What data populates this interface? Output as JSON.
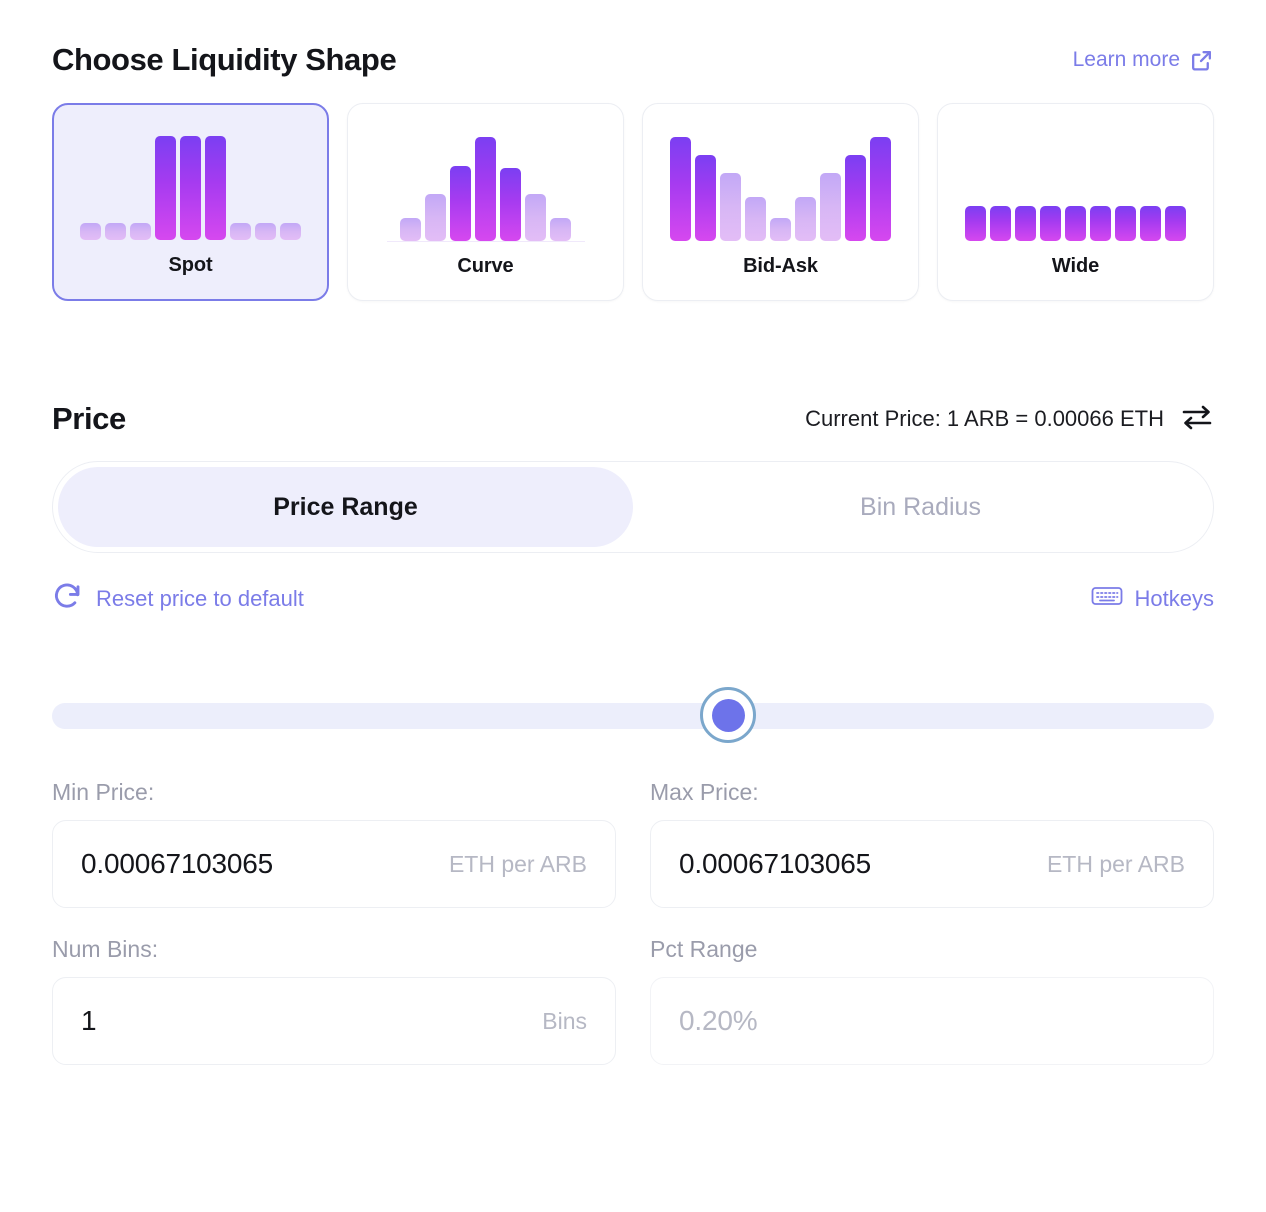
{
  "shape_section": {
    "title": "Choose Liquidity Shape",
    "learn_more": {
      "label": "Learn more",
      "icon": "external-link-icon"
    },
    "selected": "Spot",
    "cards": [
      {
        "label": "Spot",
        "bars": [
          16,
          16,
          16,
          100,
          100,
          100,
          16,
          16,
          16
        ],
        "faded": [
          true,
          true,
          true,
          false,
          false,
          false,
          true,
          true,
          true
        ],
        "baseline": false
      },
      {
        "label": "Curve",
        "bars": [
          0,
          22,
          45,
          72,
          100,
          70,
          45,
          22,
          0
        ],
        "faded": [
          true,
          true,
          false,
          false,
          false,
          false,
          true,
          true,
          true
        ],
        "baseline": true
      },
      {
        "label": "Bid-Ask",
        "bars": [
          100,
          83,
          65,
          42,
          22,
          42,
          65,
          83,
          100
        ],
        "faded": [
          false,
          false,
          true,
          true,
          true,
          true,
          true,
          false,
          false
        ],
        "baseline": false
      },
      {
        "label": "Wide",
        "bars": [
          34,
          34,
          34,
          34,
          34,
          34,
          34,
          34,
          34
        ],
        "faded": [
          false,
          false,
          false,
          false,
          false,
          false,
          false,
          false,
          false
        ],
        "baseline": false
      }
    ]
  },
  "price_section": {
    "title": "Price",
    "current_price": "Current Price: 1 ARB = 0.00066 ETH",
    "swap_icon": "swap-arrows-icon",
    "tabs": [
      {
        "label": "Price Range",
        "active": true
      },
      {
        "label": "Bin Radius",
        "active": false
      }
    ],
    "reset_link": {
      "label": "Reset price to default",
      "icon": "refresh-icon"
    },
    "hotkeys_link": {
      "label": "Hotkeys",
      "icon": "keyboard-icon"
    },
    "slider": {
      "value_pct": 58.2
    },
    "fields": {
      "min_price": {
        "label": "Min Price:",
        "value": "0.00067103065",
        "suffix": "ETH per ARB"
      },
      "max_price": {
        "label": "Max Price:",
        "value": "0.00067103065",
        "suffix": "ETH per ARB"
      },
      "num_bins": {
        "label": "Num Bins:",
        "value": "1",
        "suffix": "Bins"
      },
      "pct_range": {
        "label": "Pct Range",
        "placeholder": "0.20%",
        "suffix": ""
      }
    }
  },
  "colors": {
    "accent": "#7b7ce8",
    "bar_gradient_start": "#7b3ff2",
    "bar_gradient_end": "#d648ef",
    "selected_card_bg": "#eeeefc",
    "slider_knob": "#6d73ea",
    "slider_ring": "#7ba7cc",
    "text_primary": "#14151a",
    "text_muted": "#9a9cab"
  }
}
